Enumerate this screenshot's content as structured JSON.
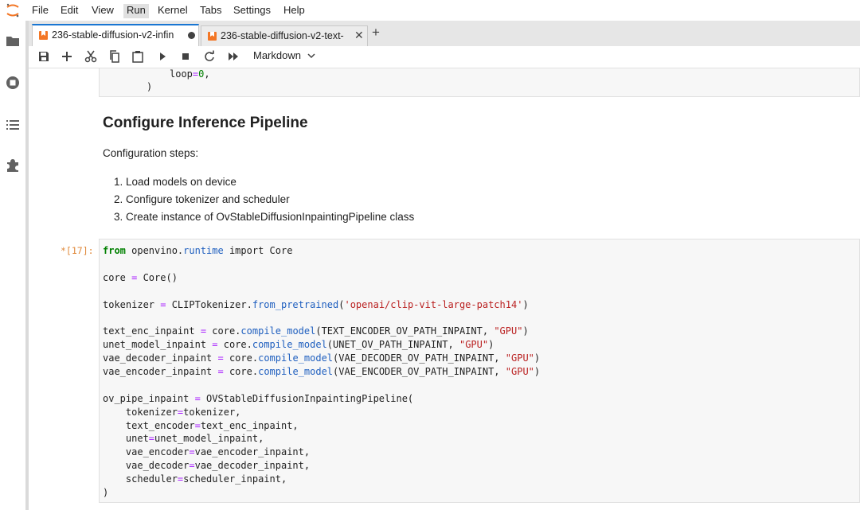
{
  "menu": {
    "items": [
      "File",
      "Edit",
      "View",
      "Run",
      "Kernel",
      "Tabs",
      "Settings",
      "Help"
    ],
    "active": "Run"
  },
  "tabs": [
    {
      "label": "236-stable-diffusion-v2-infin",
      "modified": true,
      "active": true
    },
    {
      "label": "236-stable-diffusion-v2-text-",
      "modified": false,
      "active": false
    }
  ],
  "toolbar": {
    "cell_type": "Markdown",
    "buttons": [
      "save-icon",
      "add-icon",
      "cut-icon",
      "copy-icon",
      "paste-icon",
      "run-icon",
      "stop-icon",
      "restart-icon",
      "fast-forward-icon"
    ]
  },
  "sidebar_icons": [
    "folder-icon",
    "running-icon",
    "toc-icon",
    "extension-icon"
  ],
  "prev_cell": {
    "line1": "loop=0,",
    "line2": ")"
  },
  "markdown": {
    "heading": "Configure Inference Pipeline",
    "paragraph": "Configuration steps:",
    "steps": [
      "1. Load models on device",
      "2. Configure tokenizer and scheduler",
      "3. Create instance of OvStableDiffusionInpaintingPipeline class"
    ]
  },
  "code_cell": {
    "prompt": "*[17]:",
    "lines": [
      "from openvino.runtime import Core",
      "",
      "core = Core()",
      "",
      "tokenizer = CLIPTokenizer.from_pretrained('openai/clip-vit-large-patch14')",
      "",
      "text_enc_inpaint = core.compile_model(TEXT_ENCODER_OV_PATH_INPAINT, \"GPU\")",
      "unet_model_inpaint = core.compile_model(UNET_OV_PATH_INPAINT, \"GPU\")",
      "vae_decoder_inpaint = core.compile_model(VAE_DECODER_OV_PATH_INPAINT, \"GPU\")",
      "vae_encoder_inpaint = core.compile_model(VAE_ENCODER_OV_PATH_INPAINT, \"GPU\")",
      "",
      "ov_pipe_inpaint = OVStableDiffusionInpaintingPipeline(",
      "    tokenizer=tokenizer,",
      "    text_encoder=text_enc_inpaint,",
      "    unet=unet_model_inpaint,",
      "    vae_encoder=vae_encoder_inpaint,",
      "    vae_decoder=vae_decoder_inpaint,",
      "    scheduler=scheduler_inpaint,",
      ")"
    ]
  },
  "colors": {
    "accent": "#1976d2",
    "notebook_icon": "#f37726",
    "keyword": "#008000",
    "string": "#ba2121",
    "function": "#1f5fbf",
    "operator": "#aa22ff",
    "prompt": "#e08a3c"
  }
}
